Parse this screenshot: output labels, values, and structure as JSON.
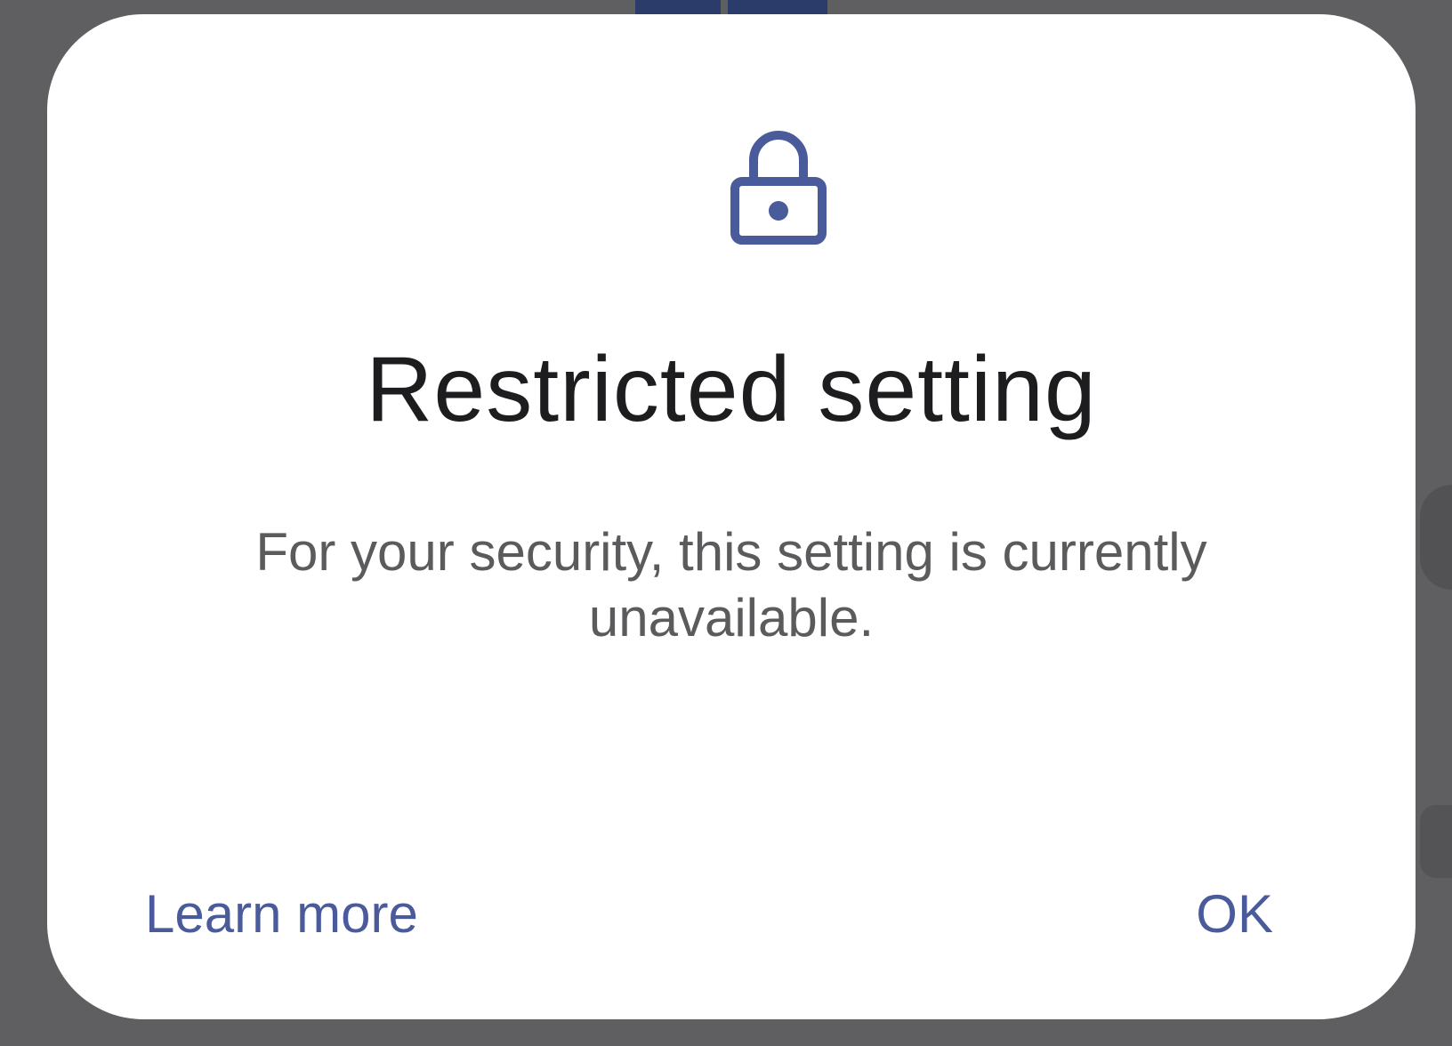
{
  "dialog": {
    "icon": "lock-icon",
    "title": "Restricted setting",
    "message": "For your security, this setting is currently unavailable.",
    "learn_more_label": "Learn more",
    "ok_label": "OK"
  },
  "colors": {
    "scrim": "#5f5f61",
    "dialog_background": "#ffffff",
    "title": "#1d1d1f",
    "message": "#5b5b5e",
    "accent": "#4a5b9b",
    "icon": "#4a5b9b"
  }
}
